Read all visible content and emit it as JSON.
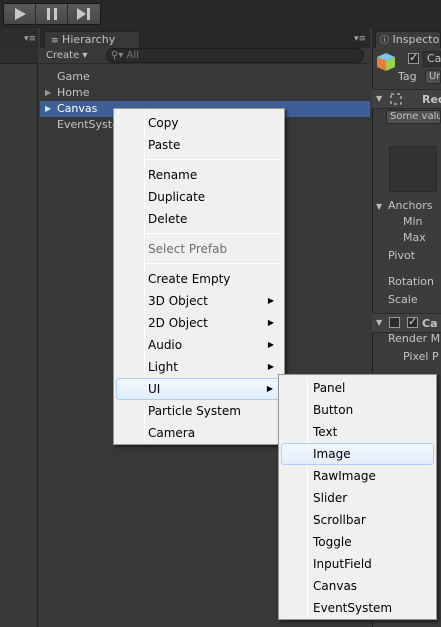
{
  "toolbar": {
    "play_icon": "play-icon",
    "pause_icon": "pause-icon",
    "step_icon": "step-icon"
  },
  "hierarchy": {
    "tab_label": "Hierarchy",
    "create_label": "Create ▾",
    "search_placeholder": "All",
    "rows": [
      {
        "label": "Game",
        "has_arrow": false,
        "selected": false
      },
      {
        "label": "Home",
        "has_arrow": true,
        "selected": false
      },
      {
        "label": "Canvas",
        "has_arrow": true,
        "selected": true
      },
      {
        "label": "EventSystem",
        "has_arrow": false,
        "selected": false
      }
    ]
  },
  "inspector": {
    "tab_label": "Inspector",
    "object_name": "Ca",
    "tag_label": "Tag",
    "tag_value": "Un",
    "rect_header": "Rec",
    "some_values": "Some values",
    "anchors_label": "Anchors",
    "min_label": "Min",
    "max_label": "Max",
    "pivot_label": "Pivot",
    "rotation_label": "Rotation",
    "scale_label": "Scale",
    "canvas_header": "Ca",
    "render_mode_label": "Render M",
    "pixel_perfect_label": "Pixel P"
  },
  "context_menu": {
    "items": [
      "Copy",
      "Paste",
      "Rename",
      "Duplicate",
      "Delete",
      "Select Prefab",
      "Create Empty",
      "3D Object",
      "2D Object",
      "Audio",
      "Light",
      "UI",
      "Particle System",
      "Camera"
    ],
    "disabled": [
      "Select Prefab"
    ],
    "highlighted": "UI",
    "has_submenu": [
      "3D Object",
      "2D Object",
      "Audio",
      "Light",
      "UI"
    ]
  },
  "ui_submenu": {
    "items": [
      "Panel",
      "Button",
      "Text",
      "Image",
      "RawImage",
      "Slider",
      "Scrollbar",
      "Toggle",
      "InputField",
      "Canvas",
      "EventSystem"
    ],
    "highlighted": "Image"
  },
  "colors": {
    "selection_blue": "#3e5f96",
    "menu_bg": "#f0f0f0",
    "highlight_border": "#aecff7"
  }
}
